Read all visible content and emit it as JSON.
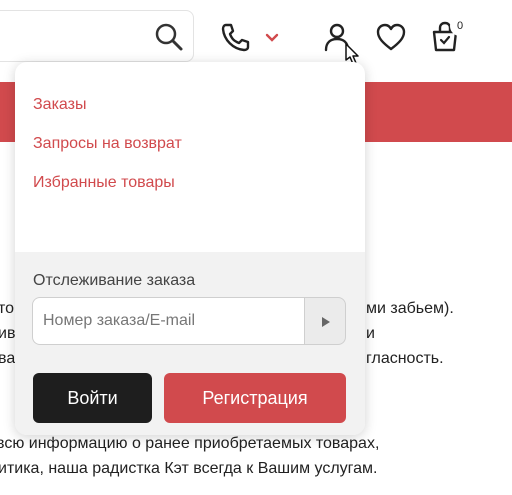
{
  "header": {
    "icons": [
      "search-icon",
      "phone-icon",
      "chevron-down-icon",
      "user-icon",
      "heart-icon",
      "cart-icon"
    ],
    "cart_count": "0",
    "accent": "#d14a4d"
  },
  "background": {
    "lines": [
      "то",
      "ми забьем).",
      "ив",
      "и",
      "ва",
      "гласность.",
      "всю информацию о ранее приобретаемых товарах,",
      "итика, наша радистка Кэт всегда к Вашим услугам."
    ]
  },
  "account_menu": {
    "links": [
      "Заказы",
      "Запросы на возврат",
      "Избранные товары"
    ],
    "tracking_label": "Отслеживание заказа",
    "tracking_placeholder": "Номер заказа/E-mail",
    "login_label": "Войти",
    "register_label": "Регистрация"
  }
}
